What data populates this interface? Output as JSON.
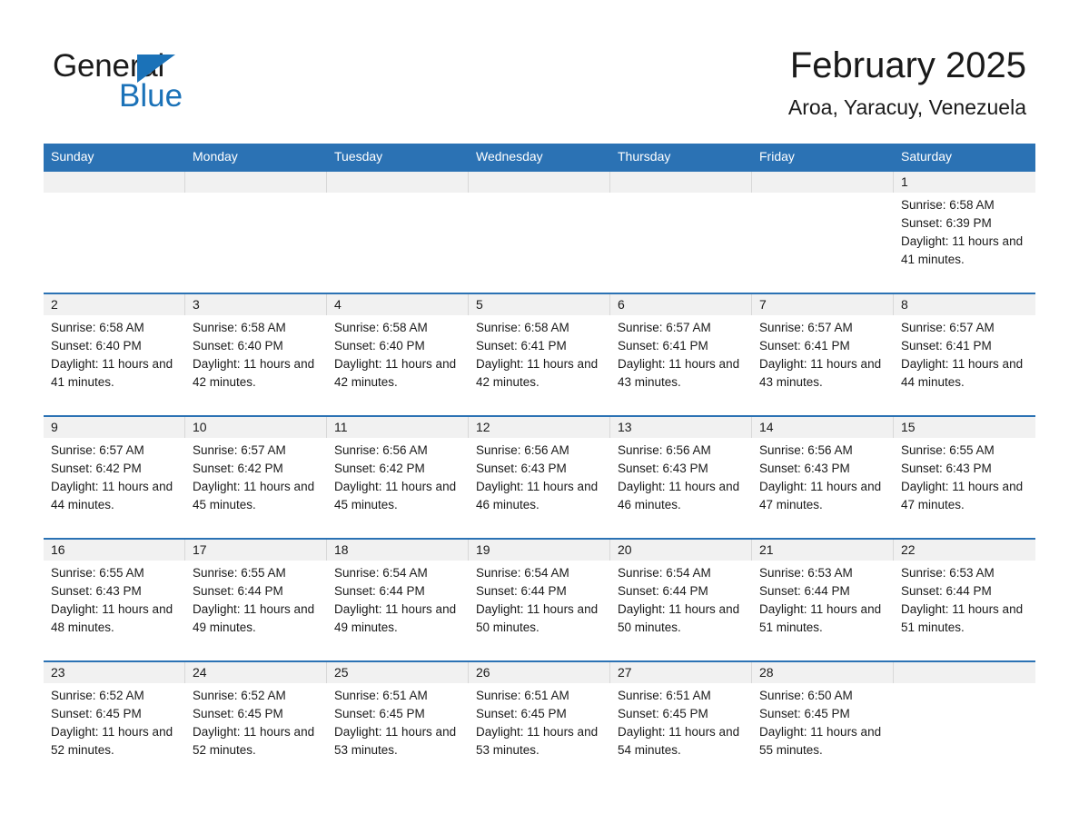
{
  "brand": {
    "name_part1": "General",
    "name_part2": "Blue",
    "accent_color": "#1b72b8"
  },
  "header": {
    "title": "February 2025",
    "subtitle": "Aroa, Yaracuy, Venezuela"
  },
  "calendar": {
    "header_color": "#2b72b4",
    "weekdays": [
      "Sunday",
      "Monday",
      "Tuesday",
      "Wednesday",
      "Thursday",
      "Friday",
      "Saturday"
    ],
    "weeks": [
      [
        {
          "day": "",
          "sunrise": "",
          "sunset": "",
          "daylight": "",
          "empty": true
        },
        {
          "day": "",
          "sunrise": "",
          "sunset": "",
          "daylight": "",
          "empty": true
        },
        {
          "day": "",
          "sunrise": "",
          "sunset": "",
          "daylight": "",
          "empty": true
        },
        {
          "day": "",
          "sunrise": "",
          "sunset": "",
          "daylight": "",
          "empty": true
        },
        {
          "day": "",
          "sunrise": "",
          "sunset": "",
          "daylight": "",
          "empty": true
        },
        {
          "day": "",
          "sunrise": "",
          "sunset": "",
          "daylight": "",
          "empty": true
        },
        {
          "day": "1",
          "sunrise": "Sunrise: 6:58 AM",
          "sunset": "Sunset: 6:39 PM",
          "daylight": "Daylight: 11 hours and 41 minutes.",
          "empty": false
        }
      ],
      [
        {
          "day": "2",
          "sunrise": "Sunrise: 6:58 AM",
          "sunset": "Sunset: 6:40 PM",
          "daylight": "Daylight: 11 hours and 41 minutes.",
          "empty": false
        },
        {
          "day": "3",
          "sunrise": "Sunrise: 6:58 AM",
          "sunset": "Sunset: 6:40 PM",
          "daylight": "Daylight: 11 hours and 42 minutes.",
          "empty": false
        },
        {
          "day": "4",
          "sunrise": "Sunrise: 6:58 AM",
          "sunset": "Sunset: 6:40 PM",
          "daylight": "Daylight: 11 hours and 42 minutes.",
          "empty": false
        },
        {
          "day": "5",
          "sunrise": "Sunrise: 6:58 AM",
          "sunset": "Sunset: 6:41 PM",
          "daylight": "Daylight: 11 hours and 42 minutes.",
          "empty": false
        },
        {
          "day": "6",
          "sunrise": "Sunrise: 6:57 AM",
          "sunset": "Sunset: 6:41 PM",
          "daylight": "Daylight: 11 hours and 43 minutes.",
          "empty": false
        },
        {
          "day": "7",
          "sunrise": "Sunrise: 6:57 AM",
          "sunset": "Sunset: 6:41 PM",
          "daylight": "Daylight: 11 hours and 43 minutes.",
          "empty": false
        },
        {
          "day": "8",
          "sunrise": "Sunrise: 6:57 AM",
          "sunset": "Sunset: 6:41 PM",
          "daylight": "Daylight: 11 hours and 44 minutes.",
          "empty": false
        }
      ],
      [
        {
          "day": "9",
          "sunrise": "Sunrise: 6:57 AM",
          "sunset": "Sunset: 6:42 PM",
          "daylight": "Daylight: 11 hours and 44 minutes.",
          "empty": false
        },
        {
          "day": "10",
          "sunrise": "Sunrise: 6:57 AM",
          "sunset": "Sunset: 6:42 PM",
          "daylight": "Daylight: 11 hours and 45 minutes.",
          "empty": false
        },
        {
          "day": "11",
          "sunrise": "Sunrise: 6:56 AM",
          "sunset": "Sunset: 6:42 PM",
          "daylight": "Daylight: 11 hours and 45 minutes.",
          "empty": false
        },
        {
          "day": "12",
          "sunrise": "Sunrise: 6:56 AM",
          "sunset": "Sunset: 6:43 PM",
          "daylight": "Daylight: 11 hours and 46 minutes.",
          "empty": false
        },
        {
          "day": "13",
          "sunrise": "Sunrise: 6:56 AM",
          "sunset": "Sunset: 6:43 PM",
          "daylight": "Daylight: 11 hours and 46 minutes.",
          "empty": false
        },
        {
          "day": "14",
          "sunrise": "Sunrise: 6:56 AM",
          "sunset": "Sunset: 6:43 PM",
          "daylight": "Daylight: 11 hours and 47 minutes.",
          "empty": false
        },
        {
          "day": "15",
          "sunrise": "Sunrise: 6:55 AM",
          "sunset": "Sunset: 6:43 PM",
          "daylight": "Daylight: 11 hours and 47 minutes.",
          "empty": false
        }
      ],
      [
        {
          "day": "16",
          "sunrise": "Sunrise: 6:55 AM",
          "sunset": "Sunset: 6:43 PM",
          "daylight": "Daylight: 11 hours and 48 minutes.",
          "empty": false
        },
        {
          "day": "17",
          "sunrise": "Sunrise: 6:55 AM",
          "sunset": "Sunset: 6:44 PM",
          "daylight": "Daylight: 11 hours and 49 minutes.",
          "empty": false
        },
        {
          "day": "18",
          "sunrise": "Sunrise: 6:54 AM",
          "sunset": "Sunset: 6:44 PM",
          "daylight": "Daylight: 11 hours and 49 minutes.",
          "empty": false
        },
        {
          "day": "19",
          "sunrise": "Sunrise: 6:54 AM",
          "sunset": "Sunset: 6:44 PM",
          "daylight": "Daylight: 11 hours and 50 minutes.",
          "empty": false
        },
        {
          "day": "20",
          "sunrise": "Sunrise: 6:54 AM",
          "sunset": "Sunset: 6:44 PM",
          "daylight": "Daylight: 11 hours and 50 minutes.",
          "empty": false
        },
        {
          "day": "21",
          "sunrise": "Sunrise: 6:53 AM",
          "sunset": "Sunset: 6:44 PM",
          "daylight": "Daylight: 11 hours and 51 minutes.",
          "empty": false
        },
        {
          "day": "22",
          "sunrise": "Sunrise: 6:53 AM",
          "sunset": "Sunset: 6:44 PM",
          "daylight": "Daylight: 11 hours and 51 minutes.",
          "empty": false
        }
      ],
      [
        {
          "day": "23",
          "sunrise": "Sunrise: 6:52 AM",
          "sunset": "Sunset: 6:45 PM",
          "daylight": "Daylight: 11 hours and 52 minutes.",
          "empty": false
        },
        {
          "day": "24",
          "sunrise": "Sunrise: 6:52 AM",
          "sunset": "Sunset: 6:45 PM",
          "daylight": "Daylight: 11 hours and 52 minutes.",
          "empty": false
        },
        {
          "day": "25",
          "sunrise": "Sunrise: 6:51 AM",
          "sunset": "Sunset: 6:45 PM",
          "daylight": "Daylight: 11 hours and 53 minutes.",
          "empty": false
        },
        {
          "day": "26",
          "sunrise": "Sunrise: 6:51 AM",
          "sunset": "Sunset: 6:45 PM",
          "daylight": "Daylight: 11 hours and 53 minutes.",
          "empty": false
        },
        {
          "day": "27",
          "sunrise": "Sunrise: 6:51 AM",
          "sunset": "Sunset: 6:45 PM",
          "daylight": "Daylight: 11 hours and 54 minutes.",
          "empty": false
        },
        {
          "day": "28",
          "sunrise": "Sunrise: 6:50 AM",
          "sunset": "Sunset: 6:45 PM",
          "daylight": "Daylight: 11 hours and 55 minutes.",
          "empty": false
        },
        {
          "day": "",
          "sunrise": "",
          "sunset": "",
          "daylight": "",
          "empty": true
        }
      ]
    ]
  }
}
